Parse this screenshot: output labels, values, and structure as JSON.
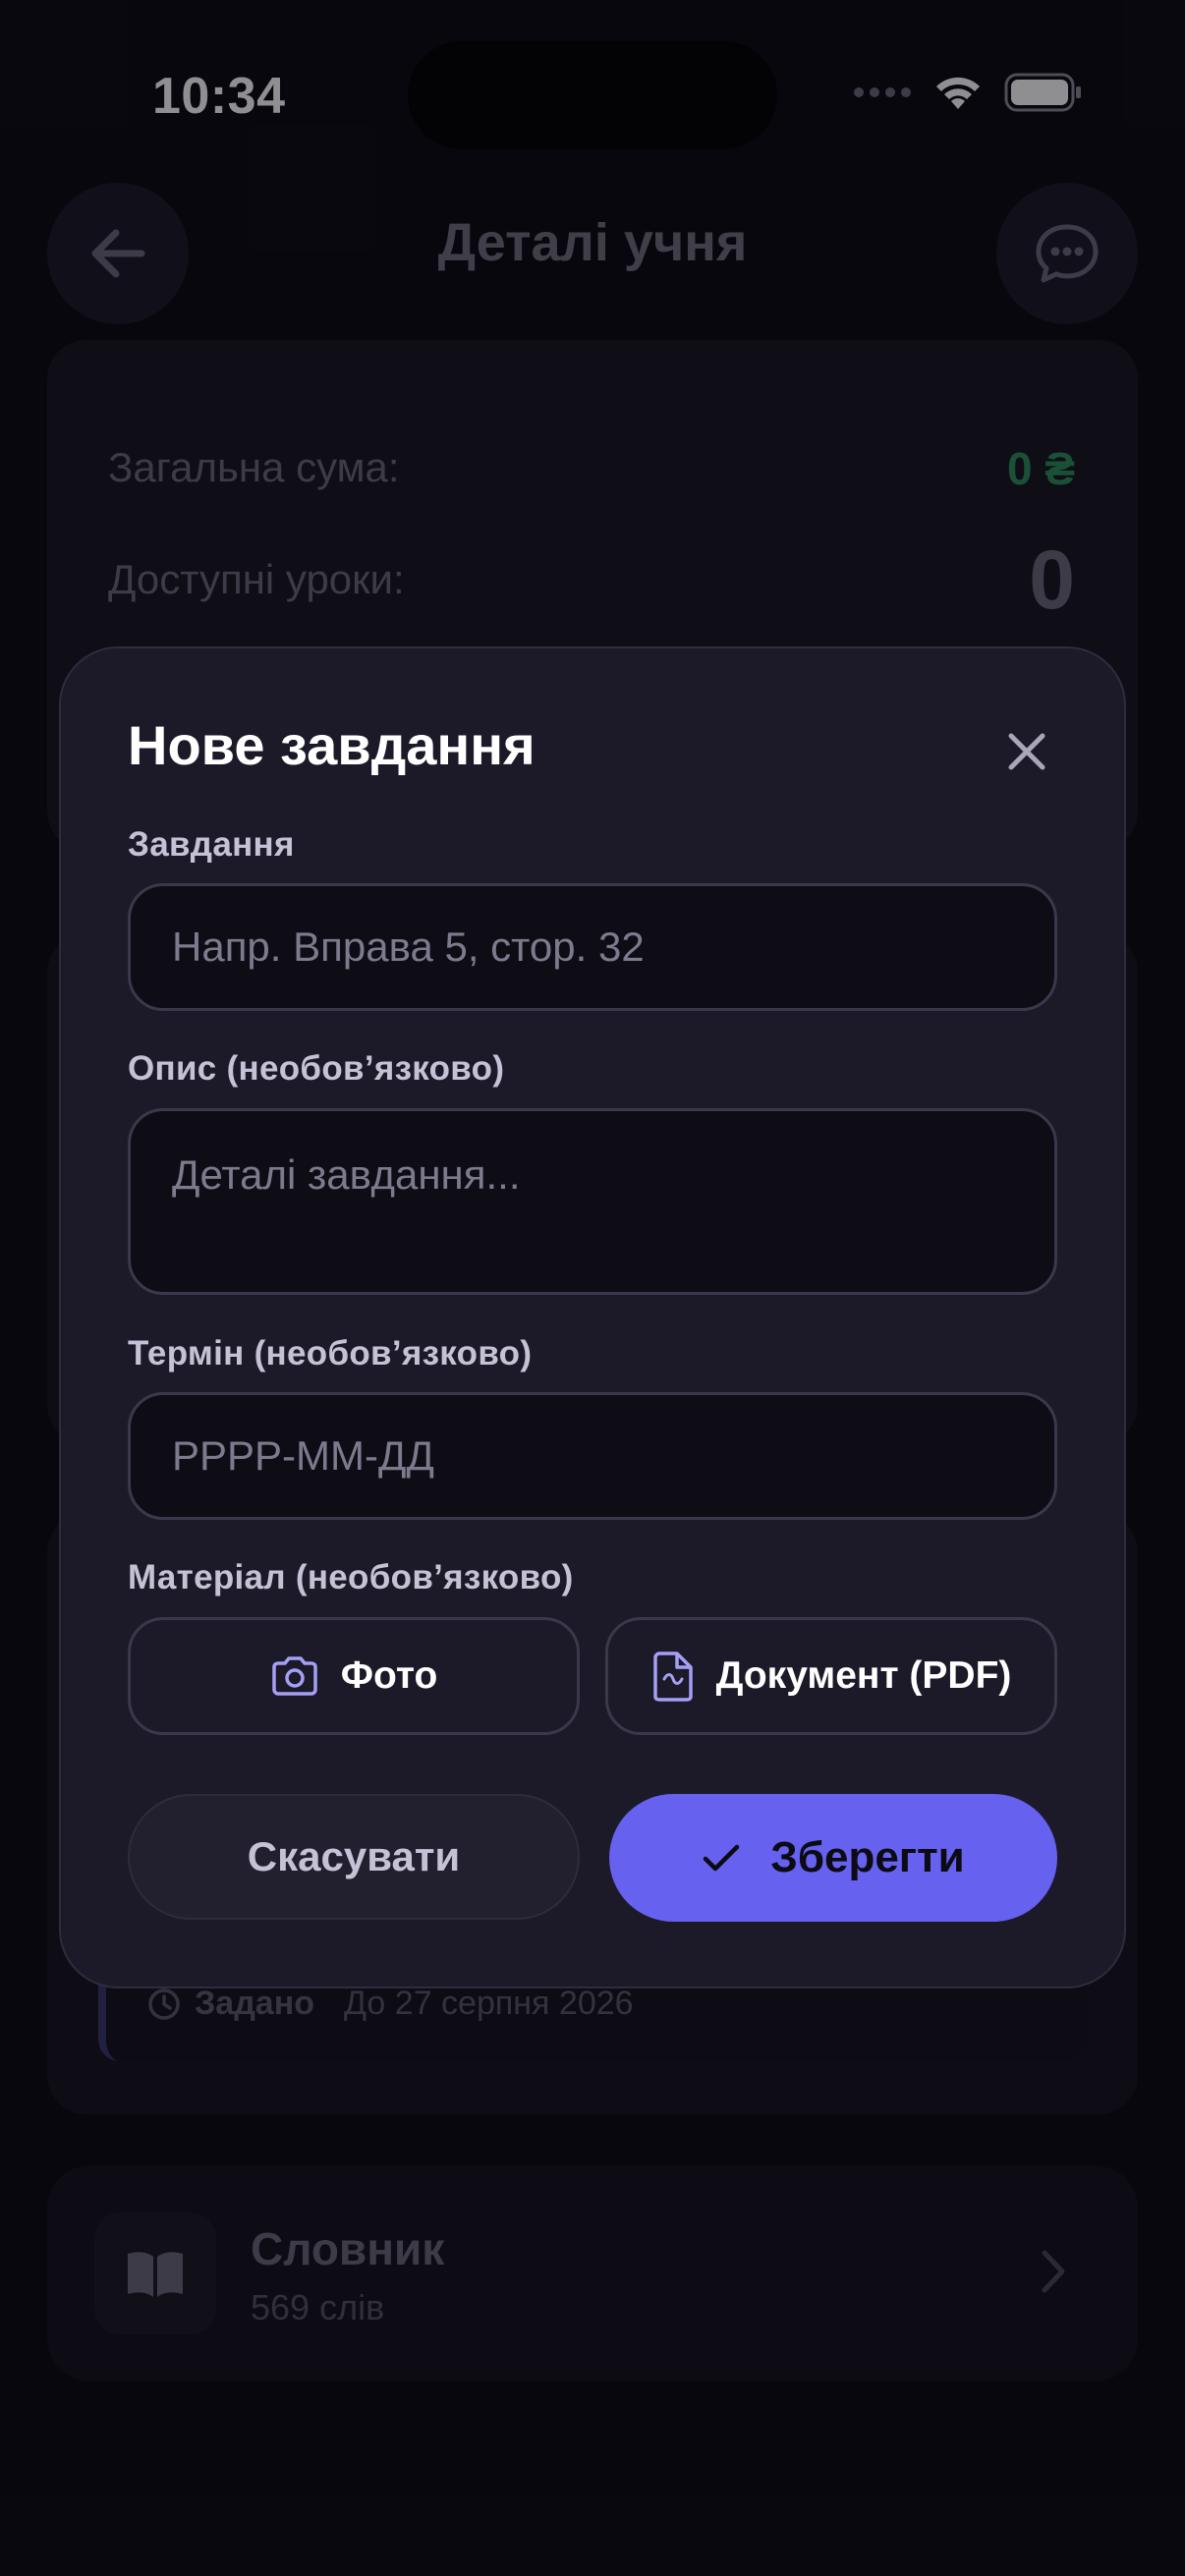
{
  "status_bar": {
    "time": "10:34"
  },
  "screen": {
    "title": "Деталі учня",
    "summary": {
      "total_label": "Загальна сума:",
      "total_value": "0 ₴",
      "lessons_label": "Доступні уроки:",
      "lessons_value": "0"
    },
    "assignment": {
      "status": "Задано",
      "due": "До 27 серпня 2026"
    },
    "vocabulary": {
      "title": "Словник",
      "subtitle": "569 слів"
    }
  },
  "modal": {
    "title": "Нове завдання",
    "task": {
      "label": "Завдання",
      "placeholder": "Напр. Вправа 5, стор. 32"
    },
    "description": {
      "label": "Опис (необовʼязково)",
      "placeholder": "Деталі завдання..."
    },
    "deadline": {
      "label": "Термін (необовʼязково)",
      "placeholder": "РРРР-ММ-ДД"
    },
    "material": {
      "label": "Матеріал (необовʼязково)",
      "photo_label": "Фото",
      "document_label": "Документ (PDF)"
    },
    "cancel_label": "Скасувати",
    "save_label": "Зберегти"
  },
  "colors": {
    "accent": "#6661ee",
    "background": "#0b0a12",
    "modal": "#1c1a28",
    "money_green": "#2b8e5c"
  },
  "icons": [
    "back-arrow-icon",
    "chat-bubble-icon",
    "close-icon",
    "camera-icon",
    "document-icon",
    "checkmark-icon",
    "clock-icon",
    "book-icon",
    "chevron-right-icon",
    "wifi-icon",
    "battery-icon",
    "cellular-icon"
  ]
}
